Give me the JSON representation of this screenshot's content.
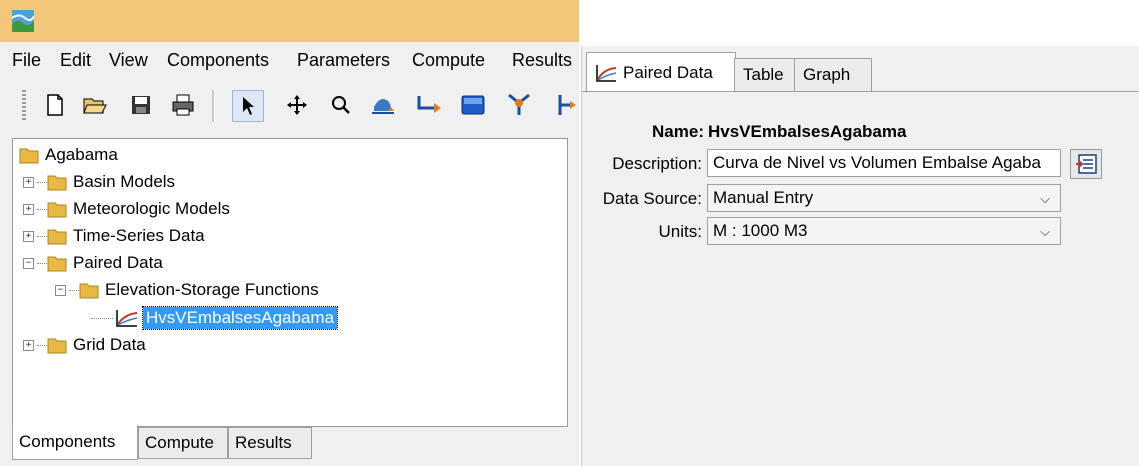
{
  "menu": [
    "File",
    "Edit",
    "View",
    "Components",
    "Parameters",
    "Compute",
    "Results"
  ],
  "toolbar": {
    "icons": [
      "new-file-icon",
      "open-folder-icon",
      "save-icon",
      "print-icon",
      "arrow-pointer-icon",
      "move-icon",
      "zoom-icon",
      "subbasin-icon",
      "reach-icon",
      "reservoir-icon",
      "junction-icon",
      "diversion-icon"
    ]
  },
  "tree": {
    "root": "Agabama",
    "items": [
      {
        "label": "Basin Models",
        "expander": "+"
      },
      {
        "label": "Meteorologic Models",
        "expander": "+"
      },
      {
        "label": "Time-Series Data",
        "expander": "+"
      },
      {
        "label": "Paired Data",
        "expander": "−"
      },
      {
        "label": "Elevation-Storage Functions",
        "expander": "−"
      },
      {
        "label": "HvsVEmbalsesAgabama",
        "selected": true
      },
      {
        "label": "Grid Data",
        "expander": "+"
      }
    ]
  },
  "bottom_tabs": [
    "Components",
    "Compute",
    "Results"
  ],
  "right_tabs": [
    "Paired Data",
    "Table",
    "Graph"
  ],
  "form": {
    "name_label": "Name:",
    "name_value": "HvsVEmbalsesAgabama",
    "description_label": "Description:",
    "description_value": "Curva de Nivel vs Volumen Embalse Agaba",
    "data_source_label": "Data Source:",
    "data_source_value": "Manual Entry",
    "units_label": "Units:",
    "units_value": "M : 1000 M3"
  },
  "colors": {
    "titlebar": "#f2c77a",
    "selection": "#3399ff"
  }
}
